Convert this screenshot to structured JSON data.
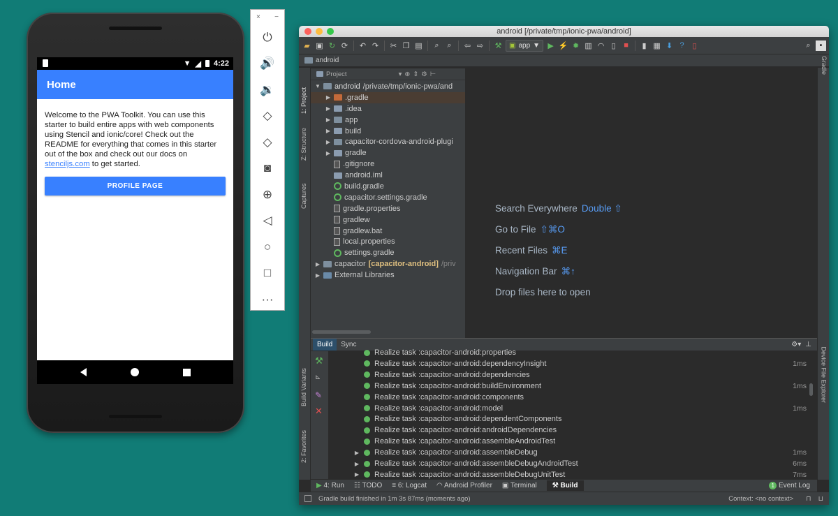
{
  "phone": {
    "status_time": "4:22",
    "app_title": "Home",
    "body_text": "Welcome to the PWA Toolkit. You can use this starter to build entire apps with web components using Stencil and ionic/core! Check out the README for everything that comes in this starter out of the box and check out our docs on ",
    "link_text": "stenciljs.com",
    "body_tail": " to get started.",
    "button_label": "PROFILE PAGE"
  },
  "emulator": {
    "close": "×",
    "minimize": "−",
    "buttons": [
      "power",
      "volume-up",
      "volume-down",
      "rotate-left",
      "rotate-right",
      "camera",
      "zoom",
      "back",
      "home",
      "overview",
      "more"
    ]
  },
  "studio": {
    "window_title": "android [/private/tmp/ionic-pwa/android]",
    "run_config": "app",
    "breadcrumb": "android",
    "project_view": "Project",
    "left_tabs": [
      "1: Project",
      "Z: Structure",
      "Captures",
      "Build Variants",
      "2: Favorites"
    ],
    "right_tabs": [
      "Gradle",
      "Device File Explorer"
    ],
    "tree": [
      {
        "label": "android",
        "extra": "/private/tmp/ionic-pwa/and",
        "indent": 0,
        "arrow": "▼",
        "icon": "folder-mod",
        "bold": true
      },
      {
        "label": ".gradle",
        "indent": 1,
        "arrow": "▶",
        "icon": "folder-orange",
        "selected": true
      },
      {
        "label": ".idea",
        "indent": 1,
        "arrow": "▶",
        "icon": "folder"
      },
      {
        "label": "app",
        "indent": 1,
        "arrow": "▶",
        "icon": "folder-mod"
      },
      {
        "label": "build",
        "indent": 1,
        "arrow": "▶",
        "icon": "folder"
      },
      {
        "label": "capacitor-cordova-android-plugi",
        "indent": 1,
        "arrow": "▶",
        "icon": "folder-mod"
      },
      {
        "label": "gradle",
        "indent": 1,
        "arrow": "▶",
        "icon": "folder"
      },
      {
        "label": ".gitignore",
        "indent": 1,
        "arrow": "",
        "icon": "file"
      },
      {
        "label": "android.iml",
        "indent": 1,
        "arrow": "",
        "icon": "folder"
      },
      {
        "label": "build.gradle",
        "indent": 1,
        "arrow": "",
        "icon": "gradle"
      },
      {
        "label": "capacitor.settings.gradle",
        "indent": 1,
        "arrow": "",
        "icon": "gradle"
      },
      {
        "label": "gradle.properties",
        "indent": 1,
        "arrow": "",
        "icon": "file"
      },
      {
        "label": "gradlew",
        "indent": 1,
        "arrow": "",
        "icon": "file"
      },
      {
        "label": "gradlew.bat",
        "indent": 1,
        "arrow": "",
        "icon": "file"
      },
      {
        "label": "local.properties",
        "indent": 1,
        "arrow": "",
        "icon": "file"
      },
      {
        "label": "settings.gradle",
        "indent": 1,
        "arrow": "",
        "icon": "gradle"
      },
      {
        "label": "capacitor",
        "extra": "[capacitor-android]",
        "extra2": "/priv",
        "indent": 0,
        "arrow": "▶",
        "icon": "folder-mod"
      },
      {
        "label": "External Libraries",
        "indent": 0,
        "arrow": "▶",
        "icon": "lib"
      }
    ],
    "hints": [
      {
        "label": "Search Everywhere",
        "key": "Double ⇧"
      },
      {
        "label": "Go to File",
        "key": "⇧⌘O"
      },
      {
        "label": "Recent Files",
        "key": "⌘E"
      },
      {
        "label": "Navigation Bar",
        "key": "⌘↑"
      },
      {
        "label": "Drop files here to open",
        "key": ""
      }
    ],
    "build_tabs": [
      "Build",
      "Sync"
    ],
    "build_rows": [
      {
        "arrow": "",
        "text": "Realize task :capacitor-android:properties",
        "time": ""
      },
      {
        "arrow": "",
        "text": "Realize task :capacitor-android:dependencyInsight",
        "time": "1ms"
      },
      {
        "arrow": "",
        "text": "Realize task :capacitor-android:dependencies",
        "time": ""
      },
      {
        "arrow": "",
        "text": "Realize task :capacitor-android:buildEnvironment",
        "time": "1ms"
      },
      {
        "arrow": "",
        "text": "Realize task :capacitor-android:components",
        "time": ""
      },
      {
        "arrow": "",
        "text": "Realize task :capacitor-android:model",
        "time": "1ms"
      },
      {
        "arrow": "",
        "text": "Realize task :capacitor-android:dependentComponents",
        "time": ""
      },
      {
        "arrow": "",
        "text": "Realize task :capacitor-android:androidDependencies",
        "time": ""
      },
      {
        "arrow": "",
        "text": "Realize task :capacitor-android:assembleAndroidTest",
        "time": ""
      },
      {
        "arrow": "▶",
        "text": "Realize task :capacitor-android:assembleDebug",
        "time": "1ms"
      },
      {
        "arrow": "▶",
        "text": "Realize task :capacitor-android:assembleDebugAndroidTest",
        "time": "6ms"
      },
      {
        "arrow": "▶",
        "text": "Realize task :capacitor-android:assembleDebugUnitTest",
        "time": "7ms"
      }
    ],
    "bottom_tabs": {
      "run": "4: Run",
      "todo": "TODO",
      "logcat": "6: Logcat",
      "profiler": "Android Profiler",
      "terminal": "Terminal",
      "build": "Build",
      "event_log": "Event Log",
      "event_count": "1"
    },
    "status_text": "Gradle build finished in 1m 3s 87ms (moments ago)",
    "context_text": "Context: <no context>"
  }
}
